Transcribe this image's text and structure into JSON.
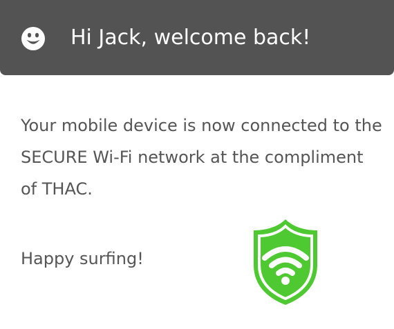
{
  "header": {
    "greeting": "Hi Jack, welcome back!",
    "icon": "smiley-face-icon",
    "background_color": "#535353"
  },
  "message": {
    "body": "Your mobile device is now connected to the SECURE Wi-Fi network at the compliment of THAC.",
    "closing": "Happy surfing!"
  },
  "badge": {
    "icon": "secure-wifi-shield-icon",
    "color": "#4fc931"
  }
}
